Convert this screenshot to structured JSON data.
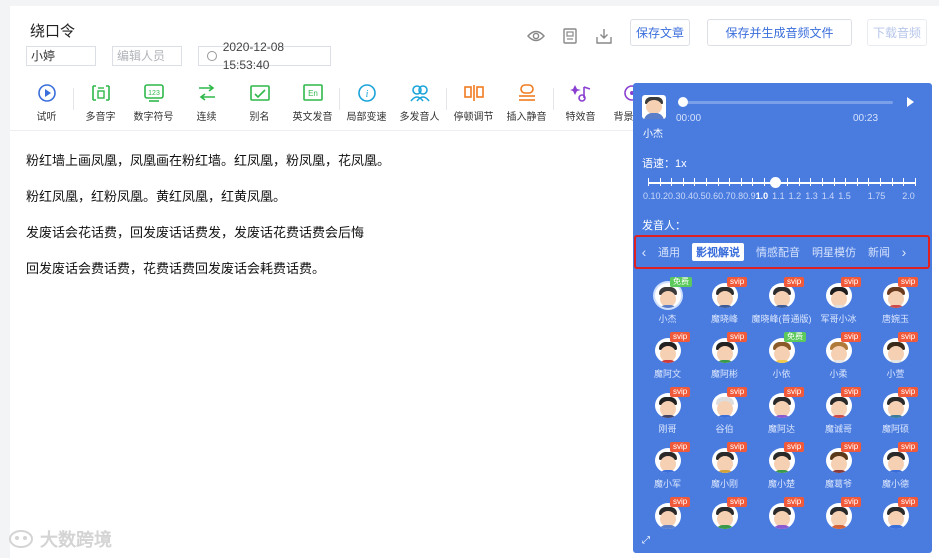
{
  "document": {
    "title": "绕口令",
    "author": "小婷",
    "editor_placeholder": "编辑人员",
    "date": "2020-12-08 15:53:40",
    "paragraphs": [
      "粉红墙上画凤凰，凤凰画在粉红墙。红凤凰，粉凤凰，花凤凰。",
      "粉红凤凰，红粉凤凰。黄红凤凰，红黄凤凰。",
      "发废话会花话费，回发废话话费发，发废话花费话费会后悔",
      "回发废话会费话费，花费话费回发废话会耗费话费。"
    ]
  },
  "header": {
    "icons": [
      "eye-icon",
      "document-icon",
      "download-icon"
    ],
    "save_label": "保存文章",
    "save_generate_label": "保存并生成音频文件",
    "download_label": "下载音频"
  },
  "toolbar": {
    "tools": [
      {
        "label": "试听",
        "icon": "play-circle-icon",
        "color": "#3a6edb"
      },
      {
        "label": "多音字",
        "icon": "polyphone-icon",
        "color": "#2fb84a"
      },
      {
        "label": "数字符号",
        "icon": "number-icon",
        "color": "#2fb84a"
      },
      {
        "label": "连续",
        "icon": "continuous-icon",
        "color": "#2fb84a"
      },
      {
        "label": "别名",
        "icon": "alias-icon",
        "color": "#2fb84a"
      },
      {
        "label": "英文发音",
        "icon": "english-icon",
        "color": "#2fb84a"
      },
      {
        "label": "局部变速",
        "icon": "speed-icon",
        "color": "#1aa3d9"
      },
      {
        "label": "多发音人",
        "icon": "multi-speaker-icon",
        "color": "#1aa3d9"
      },
      {
        "label": "停顿调节",
        "icon": "pause-adjust-icon",
        "color": "#f07b1f"
      },
      {
        "label": "插入静音",
        "icon": "silence-icon",
        "color": "#f07b1f"
      },
      {
        "label": "特效音",
        "icon": "effect-sound-icon",
        "color": "#8a3fd1"
      },
      {
        "label": "背景音乐",
        "icon": "bg-music-icon",
        "color": "#8a3fd1"
      }
    ]
  },
  "panel": {
    "speaker_name": "小杰",
    "time_start": "00:00",
    "time_end": "00:23",
    "speed_label": "语速：",
    "speed_value": "1x",
    "speed_ticks": [
      "0.1",
      "0.2",
      "0.3",
      "0.4",
      "0.5",
      "0.6",
      "0.7",
      "0.8",
      "0.9",
      "1.0",
      "1.1",
      "1.2",
      "1.3",
      "1.4",
      "1.5",
      "1.75",
      "2.0"
    ],
    "current_speed": "1.0",
    "voice_label": "发音人：",
    "categories": [
      "通用",
      "影视解说",
      "情感配音",
      "明星模仿",
      "新闻"
    ],
    "active_category": "影视解说",
    "voices": [
      {
        "name": "小杰",
        "tag": "免费",
        "hair": "#3a3a3a",
        "shirt": "#5a7ec9",
        "selected": true
      },
      {
        "name": "魔晓峰",
        "tag": "svip",
        "hair": "#2d2d2d",
        "shirt": "#3b5b9a"
      },
      {
        "name": "魔晓峰(普通版)",
        "tag": "svip",
        "hair": "#2d2d2d",
        "shirt": "#3b5b9a"
      },
      {
        "name": "军哥小冰",
        "tag": "svip",
        "hair": "#1e1e1e",
        "shirt": "#e0e0e0"
      },
      {
        "name": "唐婉玉",
        "tag": "svip",
        "hair": "#6b3b1f",
        "shirt": "#c94b4b"
      },
      {
        "name": "魔阿文",
        "tag": "svip",
        "hair": "#222222",
        "shirt": "#cc3a3a"
      },
      {
        "name": "魔阿彬",
        "tag": "svip",
        "hair": "#222222",
        "shirt": "#3a9a4a"
      },
      {
        "name": "小依",
        "tag": "免费",
        "hair": "#8a5a2a",
        "shirt": "#f2c94c"
      },
      {
        "name": "小柔",
        "tag": "svip",
        "hair": "#b07a3a",
        "shirt": "#e5e5e5"
      },
      {
        "name": "小萱",
        "tag": "svip",
        "hair": "#3a2a1a",
        "shirt": "#e5e5e5"
      },
      {
        "name": "刚哥",
        "tag": "svip",
        "hair": "#222222",
        "shirt": "#444466"
      },
      {
        "name": "谷伯",
        "tag": "svip",
        "hair": "#dddddd",
        "shirt": "#3a6edb"
      },
      {
        "name": "魔阿达",
        "tag": "svip",
        "hair": "#2a2a2a",
        "shirt": "#8a5ad1"
      },
      {
        "name": "魔诚哥",
        "tag": "svip",
        "hair": "#2a2a2a",
        "shirt": "#c94b4b"
      },
      {
        "name": "魔阿硕",
        "tag": "svip",
        "hair": "#2a2a2a",
        "shirt": "#3a7a9a"
      },
      {
        "name": "魔小军",
        "tag": "svip",
        "hair": "#2a2a2a",
        "shirt": "#3a6edb"
      },
      {
        "name": "魔小刚",
        "tag": "svip",
        "hair": "#2a2a2a",
        "shirt": "#d1a23a"
      },
      {
        "name": "魔小楚",
        "tag": "svip",
        "hair": "#2a2a2a",
        "shirt": "#3a9a4a"
      },
      {
        "name": "魔葛爷",
        "tag": "svip",
        "hair": "#5a3a1a",
        "shirt": "#8a3a3a"
      },
      {
        "name": "魔小德",
        "tag": "svip",
        "hair": "#2a2a2a",
        "shirt": "#3a6edb"
      },
      {
        "name": "",
        "tag": "svip",
        "hair": "#2a2a2a",
        "shirt": "#5a7ec9"
      },
      {
        "name": "",
        "tag": "svip",
        "hair": "#2a2a2a",
        "shirt": "#3a9a4a"
      },
      {
        "name": "",
        "tag": "svip",
        "hair": "#2a2a2a",
        "shirt": "#8a5ad1"
      },
      {
        "name": "",
        "tag": "svip",
        "hair": "#2a2a2a",
        "shirt": "#d1623a"
      },
      {
        "name": "",
        "tag": "svip",
        "hair": "#2a2a2a",
        "shirt": "#3a6edb"
      }
    ]
  },
  "watermark": "大数跨境",
  "colors": {
    "accent": "#3a6edb",
    "panel_bg": "#4a7ce0",
    "highlight_border": "#e02020",
    "svip_tag": "#f05a3a",
    "free_tag": "#5cc95c"
  }
}
